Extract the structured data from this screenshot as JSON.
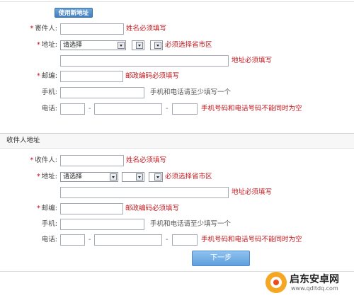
{
  "sender": {
    "new_address_button": "使用新地址",
    "name_label": "寄件人:",
    "name_error": "姓名必须填写",
    "address_label": "地址:",
    "province_select": "请选择",
    "region_error": "必须选择省市区",
    "address_error": "地址必须填写",
    "postcode_label": "邮编:",
    "postcode_error": "邮政编码必须填写",
    "mobile_label": "手机:",
    "mobile_hint": "手机和电话请至少填写一个",
    "phone_label": "电话:",
    "phone_dash": "-",
    "phone_error": "手机号码和电话号码不能同时为空"
  },
  "recipient": {
    "section_title": "收件人地址",
    "name_label": "收件人:",
    "name_error": "姓名必须填写",
    "address_label": "地址:",
    "province_select": "请选择",
    "region_error": "必须选择省市区",
    "address_error": "地址必须填写",
    "postcode_label": "邮编:",
    "postcode_error": "邮政编码必须填写",
    "mobile_label": "手机:",
    "mobile_hint": "手机和电话请至少填写一个",
    "phone_label": "电话:",
    "phone_dash": "-",
    "phone_error": "手机号码和电话号码不能同时为空"
  },
  "actions": {
    "next_button": "下一步"
  },
  "watermark": {
    "title": "启东安卓网",
    "url": "www.qdltdq.com"
  },
  "icons": {
    "required_marker": "*",
    "select_arrow": "chevron-down-icon"
  }
}
